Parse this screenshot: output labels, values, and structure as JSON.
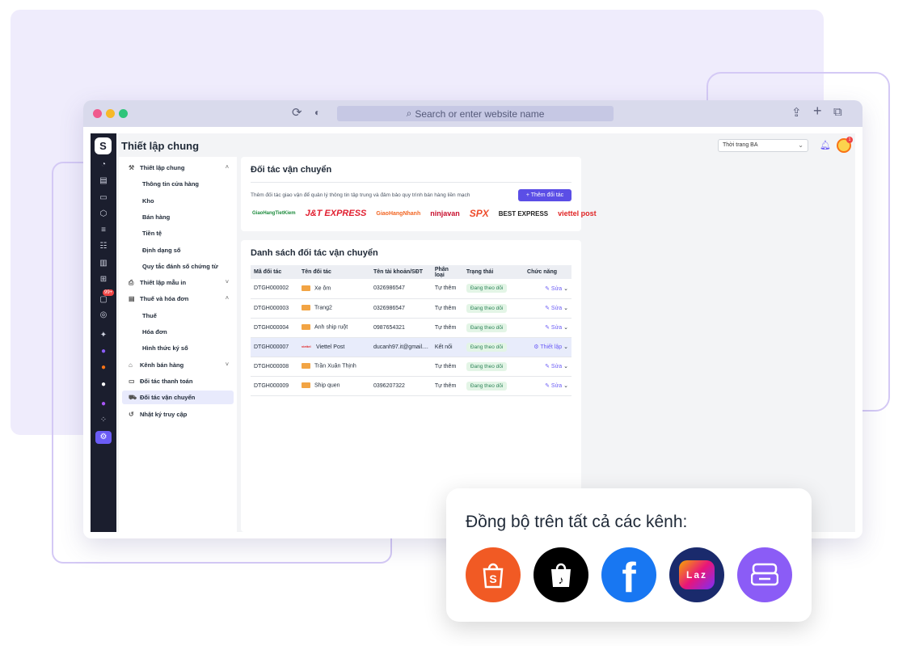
{
  "browser": {
    "url_placeholder": "Search or enter website name"
  },
  "app": {
    "page_title": "Thiết lập chung",
    "store_select": "Thời trang BA",
    "notification_badge": "1",
    "chat_badge": "99+"
  },
  "menu": {
    "general_group": "Thiết lập chung",
    "general_items": [
      "Thông tin cửa hàng",
      "Kho",
      "Bán hàng",
      "Tiền tệ",
      "Định dạng số",
      "Quy tắc đánh số chứng từ"
    ],
    "print_group": "Thiết lập mẫu in",
    "tax_group": "Thuế và hóa đơn",
    "tax_items": [
      "Thuế",
      "Hóa đơn",
      "Hình thức ký số"
    ],
    "sales_channels": "Kênh bán hàng",
    "payment_partners": "Đối tác thanh toán",
    "shipping_partners": "Đối tác vận chuyển",
    "access_log": "Nhật ký truy cập"
  },
  "partners_card": {
    "title": "Đối tác vận chuyển",
    "description": "Thêm đối tác giao vận để quản lý thông tin tập trung và đảm bảo quy trình bán hàng liền mạch",
    "add_button": "+ Thêm đối tác",
    "logos": [
      "GiaoHangTietKiem",
      "J&T EXPRESS",
      "GiaoHangNhanh",
      "ninjavan",
      "SPX",
      "BEST EXPRESS",
      "viettel post"
    ]
  },
  "list_card": {
    "title": "Danh sách đối tác vận chuyển",
    "columns": [
      "Mã đối tác",
      "Tên đối tác",
      "Tên tài khoản/SĐT",
      "Phân loại",
      "Trạng thái",
      "Chức năng"
    ],
    "rows": [
      {
        "code": "DTGH000002",
        "name": "Xe ôm",
        "account": "0326986547",
        "type": "Tự thêm",
        "status": "Đang theo dõi",
        "action": "Sửa"
      },
      {
        "code": "DTGH000003",
        "name": "Trang2",
        "account": "0326986547",
        "type": "Tự thêm",
        "status": "Đang theo dõi",
        "action": "Sửa"
      },
      {
        "code": "DTGH000004",
        "name": "Anh ship ruột",
        "account": "0987654321",
        "type": "Tự thêm",
        "status": "Đang theo dõi",
        "action": "Sửa"
      },
      {
        "code": "DTGH000007",
        "name": "Viettel Post",
        "account": "ducanh97.it@gmail....",
        "type": "Kết nối",
        "status": "Đang theo dõi",
        "action": "Thiết lập"
      },
      {
        "code": "DTGH000008",
        "name": "Trần Xuân Thịnh",
        "account": "",
        "type": "Tự thêm",
        "status": "Đang theo dõi",
        "action": "Sửa"
      },
      {
        "code": "DTGH000009",
        "name": "Ship quen",
        "account": "0396207322",
        "type": "Tự thêm",
        "status": "Đang theo dõi",
        "action": "Sửa"
      }
    ]
  },
  "sync": {
    "title": "Đồng bộ trên tất cả các kênh:",
    "channels": [
      "shopee-icon",
      "tiktok-shop-icon",
      "facebook-icon",
      "lazada-icon",
      "pos-icon"
    ],
    "lazada_text": "Laz"
  },
  "colors": {
    "accent": "#5b4ee6",
    "rail": "#1b1e2e",
    "status_bg": "#e3f5e6"
  }
}
